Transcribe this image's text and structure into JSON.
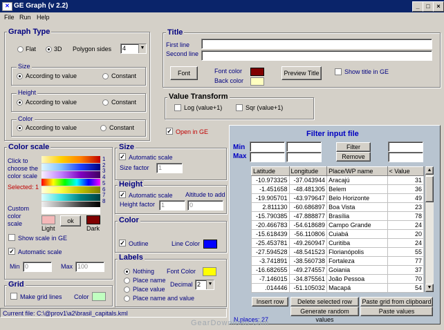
{
  "window": {
    "title": "GE Graph (v 2.2)",
    "min": "_",
    "max": "□",
    "close": "×"
  },
  "menu": [
    "File",
    "Run",
    "Help"
  ],
  "graph_type": {
    "legend": "Graph Type",
    "flat": "Flat",
    "three_d": "3D",
    "polygon_sides_label": "Polygon sides",
    "polygon_sides": "4",
    "size": {
      "legend": "Size",
      "according": "According to value",
      "constant": "Constant"
    },
    "height": {
      "legend": "Height",
      "according": "According to value",
      "constant": "Constant"
    },
    "color": {
      "legend": "Color",
      "according": "According to value",
      "constant": "Constant"
    }
  },
  "title_box": {
    "legend": "Title",
    "first_line_label": "First line",
    "second_line_label": "Second line",
    "first_line": "",
    "second_line": "",
    "font_button": "Font",
    "font_color_label": "Font color",
    "back_color_label": "Back color",
    "preview_button": "Preview Title",
    "show_title": "Show title in GE",
    "font_color": "#800000",
    "back_color": "#ffffc0"
  },
  "value_transform": {
    "legend": "Value Transform",
    "log": "Log (value+1)",
    "sqr": "Sqr (value+1)"
  },
  "open_in_ge": "Open in GE",
  "color_scale": {
    "legend": "Color scale",
    "click_text": "Click to choose the color scale",
    "selected": "Selected: 1",
    "numbers": [
      "1",
      "2",
      "3",
      "4",
      "5",
      "6",
      "7",
      "8"
    ],
    "custom_label": "Custom color scale",
    "light_label": "Light",
    "dark_label": "Dark",
    "ok_button": "ok",
    "light_color": "#f4b8b8",
    "dark_color": "#800000",
    "show_scale": "Show scale in GE",
    "automatic_scale": "Automatic scale",
    "min_label": "Min",
    "max_label": "Max",
    "min_value": "0",
    "max_value": "100"
  },
  "grid_box": {
    "legend": "Grid",
    "make_grid": "Make grid lines",
    "color_label": "Color",
    "color": "#c0ffc0"
  },
  "size_box": {
    "legend": "Size",
    "automatic": "Automatic scale",
    "factor_label": "Size factor",
    "factor": "1"
  },
  "height_box": {
    "legend": "Height",
    "automatic": "Automatic scale",
    "altitude_label": "Altitude to add",
    "factor_label": "Height factor",
    "factor": "1",
    "altitude": "0"
  },
  "color_box": {
    "legend": "Color",
    "outline": "Outline",
    "line_color_label": "Line  Color",
    "line_color": "#0000ff"
  },
  "labels_box": {
    "legend": "Labels",
    "nothing": "Nothing",
    "place_name": "Place name",
    "place_value": "Place value",
    "place_name_value": "Place name and value",
    "font_color_label": "Font Color",
    "font_color": "#ffff00",
    "decimal_label": "Decimal",
    "decimal": "2"
  },
  "filter": {
    "title": "Filter input file",
    "min_label": "Min",
    "max_label": "Max",
    "filter_button": "Filter",
    "remove_button": "Remove",
    "columns": [
      "Latitude",
      "Longitude",
      "Place/WP name",
      "< Value"
    ],
    "rows": [
      [
        "-10.973325",
        "-37.043944",
        "Aracajú",
        "31"
      ],
      [
        "-1.451658",
        "-48.481305",
        "Belem",
        "36"
      ],
      [
        "-19.905701",
        "-43.979647",
        "Belo Horizonte",
        "49"
      ],
      [
        "2.811130",
        "-60.686897",
        "Boa Vista",
        "23"
      ],
      [
        "-15.790385",
        "-47.888877",
        "Brasília",
        "78"
      ],
      [
        "-20.466783",
        "-54.618689",
        "Campo Grande",
        "24"
      ],
      [
        "-15.618439",
        "-56.110806",
        "Cuiabá",
        "20"
      ],
      [
        "-25.453781",
        "-49.260947",
        "Curitiba",
        "24"
      ],
      [
        "-27.594528",
        "-48.541523",
        "Florianópolis",
        "55"
      ],
      [
        "-3.741891",
        "-38.560738",
        "Fortaleza",
        "77"
      ],
      [
        "-16.682655",
        "-49.274557",
        "Goiania",
        "37"
      ],
      [
        "-7.146015",
        "-34.875561",
        "João Pessoa",
        "70"
      ],
      [
        ".014446",
        "-51.105032",
        "Macapá",
        "54"
      ]
    ],
    "insert_row": "Insert row",
    "delete_row": "Delete selected row",
    "paste_grid": "Paste grid from clipboard",
    "generate": "Generate random values",
    "paste_values": "Paste values",
    "nplaces": "N.places: 27"
  },
  "status": {
    "current_file": "Current file: C:\\@prov1\\a2\\brasil_capitals.kml"
  },
  "watermark": "GearDownload.com"
}
